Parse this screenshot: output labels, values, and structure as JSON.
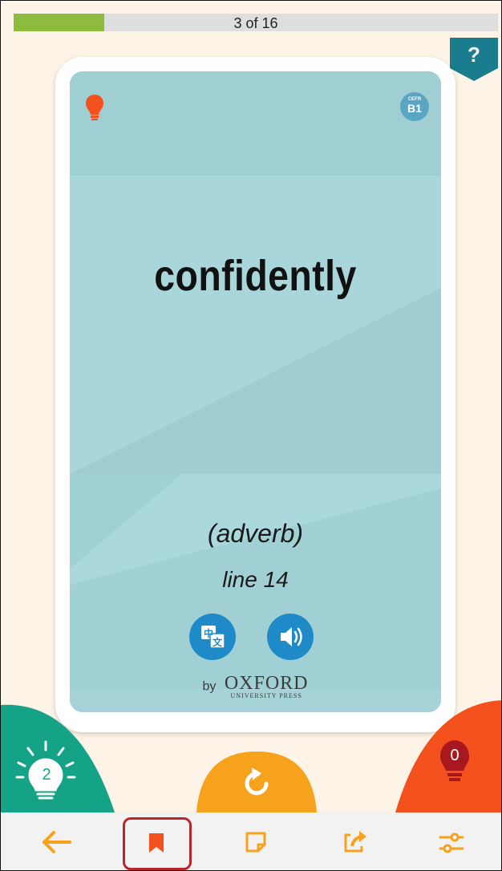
{
  "progress": {
    "label": "3 of 16",
    "fraction": 0.1875
  },
  "help": {
    "label": "?",
    "icon": "help-icon"
  },
  "card": {
    "word": "confidently",
    "part_of_speech": "(adverb)",
    "line_ref": "line 14",
    "cefr": {
      "scale": "CEFR",
      "level": "B1"
    },
    "publisher": {
      "by": "by",
      "name": "OXFORD",
      "subtitle": "UNIVERSITY PRESS"
    },
    "buttons": [
      {
        "name": "translate-button",
        "icon": "translate-icon",
        "glyph": "中文"
      },
      {
        "name": "audio-button",
        "icon": "speaker-icon"
      }
    ]
  },
  "scores": {
    "known": "2",
    "unknown": "0"
  },
  "toolbar": {
    "items": [
      {
        "name": "back-button",
        "icon": "arrow-left-icon"
      },
      {
        "name": "bookmark-button",
        "icon": "bookmark-icon",
        "selected": true
      },
      {
        "name": "note-button",
        "icon": "note-icon"
      },
      {
        "name": "share-button",
        "icon": "share-icon"
      },
      {
        "name": "settings-button",
        "icon": "sliders-icon"
      }
    ]
  },
  "colors": {
    "background": "#fdf3e6",
    "progress": "#8dbb3e",
    "card": "#a3d2d6",
    "accent_blue": "#1e8bc8",
    "orange": "#f7a21c",
    "green": "#14a386",
    "red": "#f4511e",
    "help": "#1a7d8e",
    "highlight": "#b8262c"
  }
}
